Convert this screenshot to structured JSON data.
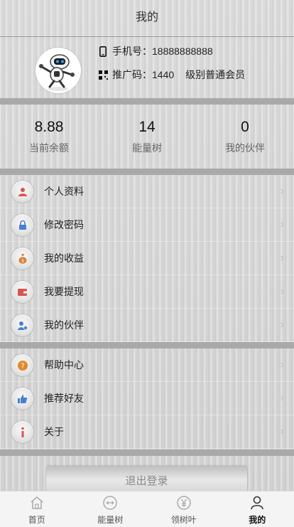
{
  "header": {
    "title": "我的"
  },
  "profile": {
    "phone_label": "手机号：",
    "phone": "18888888888",
    "promo_label": "推广码：",
    "promo_code": "1440",
    "level_label": "级别",
    "level": "普通会员"
  },
  "stats": [
    {
      "value": "8.88",
      "label": "当前余额"
    },
    {
      "value": "14",
      "label": "能量树"
    },
    {
      "value": "0",
      "label": "我的伙伴"
    }
  ],
  "menu_group1": [
    {
      "label": "个人资料",
      "icon": "user-icon"
    },
    {
      "label": "修改密码",
      "icon": "lock-icon"
    },
    {
      "label": "我的收益",
      "icon": "money-bag-icon"
    },
    {
      "label": "我要提现",
      "icon": "wallet-icon"
    },
    {
      "label": "我的伙伴",
      "icon": "partner-icon"
    }
  ],
  "menu_group2": [
    {
      "label": "帮助中心",
      "icon": "help-icon"
    },
    {
      "label": "推荐好友",
      "icon": "thumbs-up-icon"
    },
    {
      "label": "关于",
      "icon": "info-icon"
    }
  ],
  "logout": {
    "label": "退出登录"
  },
  "tabbar": [
    {
      "label": "首页",
      "icon": "home-icon",
      "active": false
    },
    {
      "label": "能量树",
      "icon": "energy-icon",
      "active": false
    },
    {
      "label": "领树叶",
      "icon": "yen-icon",
      "active": false
    },
    {
      "label": "我的",
      "icon": "person-icon",
      "active": true
    }
  ],
  "colors": {
    "divider": "#a9a9a9",
    "user_icon": "#d9534f",
    "lock_icon": "#4a7fd0",
    "money_icon": "#d9823b",
    "wallet_icon": "#d9534f",
    "help_icon": "#e08a2e",
    "info_icon": "#d9534f"
  }
}
